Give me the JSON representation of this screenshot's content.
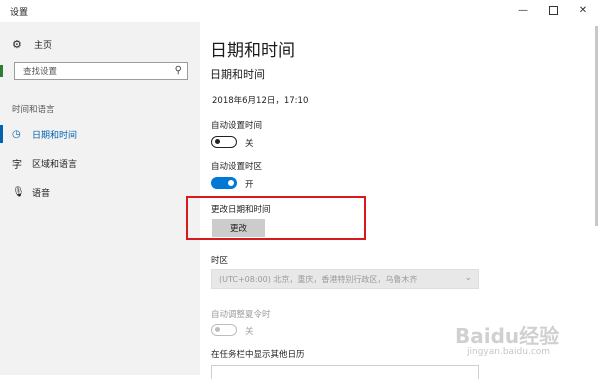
{
  "window": {
    "title": "设置",
    "controls": {
      "minimize": "—",
      "close": "✕"
    }
  },
  "sidebar": {
    "home": {
      "label": "主页",
      "icon": "gear-icon"
    },
    "search": {
      "placeholder": "查找设置",
      "value": ""
    },
    "section_label": "时间和语言",
    "items": [
      {
        "label": "日期和时间",
        "icon": "calendar-clock-icon",
        "active": true
      },
      {
        "label": "区域和语言",
        "icon": "language-icon",
        "active": false
      },
      {
        "label": "语音",
        "icon": "microphone-icon",
        "active": false
      }
    ]
  },
  "main": {
    "page_title": "日期和时间",
    "section_title": "日期和时间",
    "current_datetime": "2018年6月12日，17:10",
    "auto_time": {
      "label": "自动设置时间",
      "state_text": "关",
      "on": false
    },
    "auto_timezone": {
      "label": "自动设置时区",
      "state_text": "开",
      "on": true
    },
    "change_datetime": {
      "label": "更改日期和时间",
      "button": "更改"
    },
    "timezone": {
      "label": "时区",
      "value": "(UTC+08:00) 北京，重庆，香港特别行政区，乌鲁木齐",
      "enabled": false
    },
    "dst": {
      "label": "自动调整夏令时",
      "state_text": "关",
      "enabled": false
    },
    "extra_calendar": {
      "label": "在任务栏中显示其他日历"
    }
  },
  "colors": {
    "accent": "#0078d7",
    "highlight_box": "#d71920",
    "sidebar_bg": "#f2f2f2"
  },
  "watermark": {
    "text": "Baidu经验",
    "sub": "jingyan.baidu.com"
  }
}
